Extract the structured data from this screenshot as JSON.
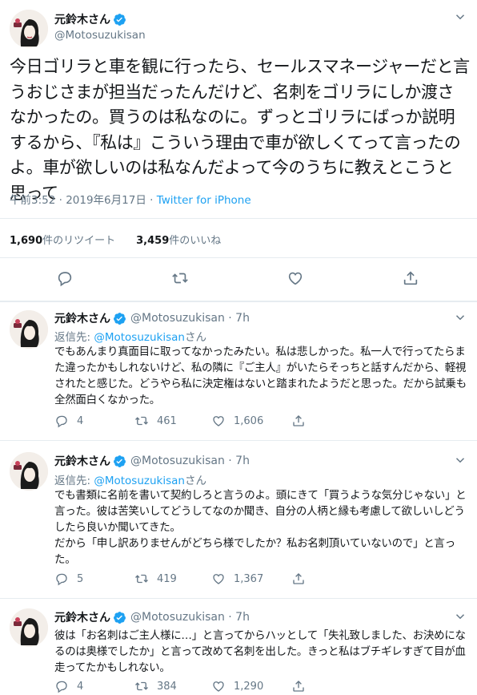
{
  "main_tweet": {
    "name": "元鈴木さん",
    "handle": "@Motosuzukisan",
    "text": "今日ゴリラと車を観に行ったら、セールスマネージャーだと言うおじさまが担当だったんだけど、名刺をゴリラにしか渡さなかったの。買うのは私なのに。ずっとゴリラにばっか説明するから、『私は』こういう理由で車が欲しくてって言ったのよ。車が欲しいのは私なんだよって今のうちに教えとこうと思って",
    "time": "午前3:52 · 2019年6月17日 · ",
    "source": "Twitter for iPhone",
    "retweets_count": "1,690",
    "retweets_label": "件のリツイート",
    "likes_count": "3,459",
    "likes_label": "件のいいね",
    "actions": [
      "reply-icon",
      "retweet-icon",
      "like-icon",
      "share-icon"
    ]
  },
  "replies": [
    {
      "name": "元鈴木さん",
      "handle_time": "@Motosuzukisan · 7h",
      "replying_prefix": "返信先: ",
      "replying_mention": "@Motosuzukisan",
      "replying_suffix": "さん",
      "text": "でもあんまり真面目に取ってなかったみたい。私は悲しかった。私一人で行ってたらまた違ったかもしれないけど、私の隣に『ご主人』がいたらそっちと話すんだから、軽視されたと感じた。どうやら私に決定権はないと踏まれたようだと思った。だから試乗も全然面白くなかった。",
      "replies": "4",
      "retweets": "461",
      "likes": "1,606"
    },
    {
      "name": "元鈴木さん",
      "handle_time": "@Motosuzukisan · 7h",
      "replying_prefix": "返信先: ",
      "replying_mention": "@Motosuzukisan",
      "replying_suffix": "さん",
      "text": "でも書類に名前を書いて契約しろと言うのよ。頭にきて「買うような気分じゃない」と言った。彼は苦笑いしてどうしてなのか聞き、自分の人柄と縁も考慮して欲しいしどうしたら良いか聞いてきた。\nだから「申し訳ありませんがどちら様でしたか？私お名刺頂いていないので」と言った。",
      "replies": "5",
      "retweets": "419",
      "likes": "1,367"
    },
    {
      "name": "元鈴木さん",
      "handle_time": "@Motosuzukisan · 7h",
      "text": "彼は「お名刺はご主人様に…」と言ってからハッとして「失礼致しました、お決めになるのは奥様でしたか」と言って改めて名刺を出した。きっと私はブチギレすぎて目が血走ってたかもしれない。",
      "replies": "4",
      "retweets": "384",
      "likes": "1,290"
    }
  ],
  "colors": {
    "text": "#14171a",
    "muted": "#657786",
    "link": "#1da1f2",
    "divider": "#e6ecf0",
    "verified": "#1da1f2"
  }
}
